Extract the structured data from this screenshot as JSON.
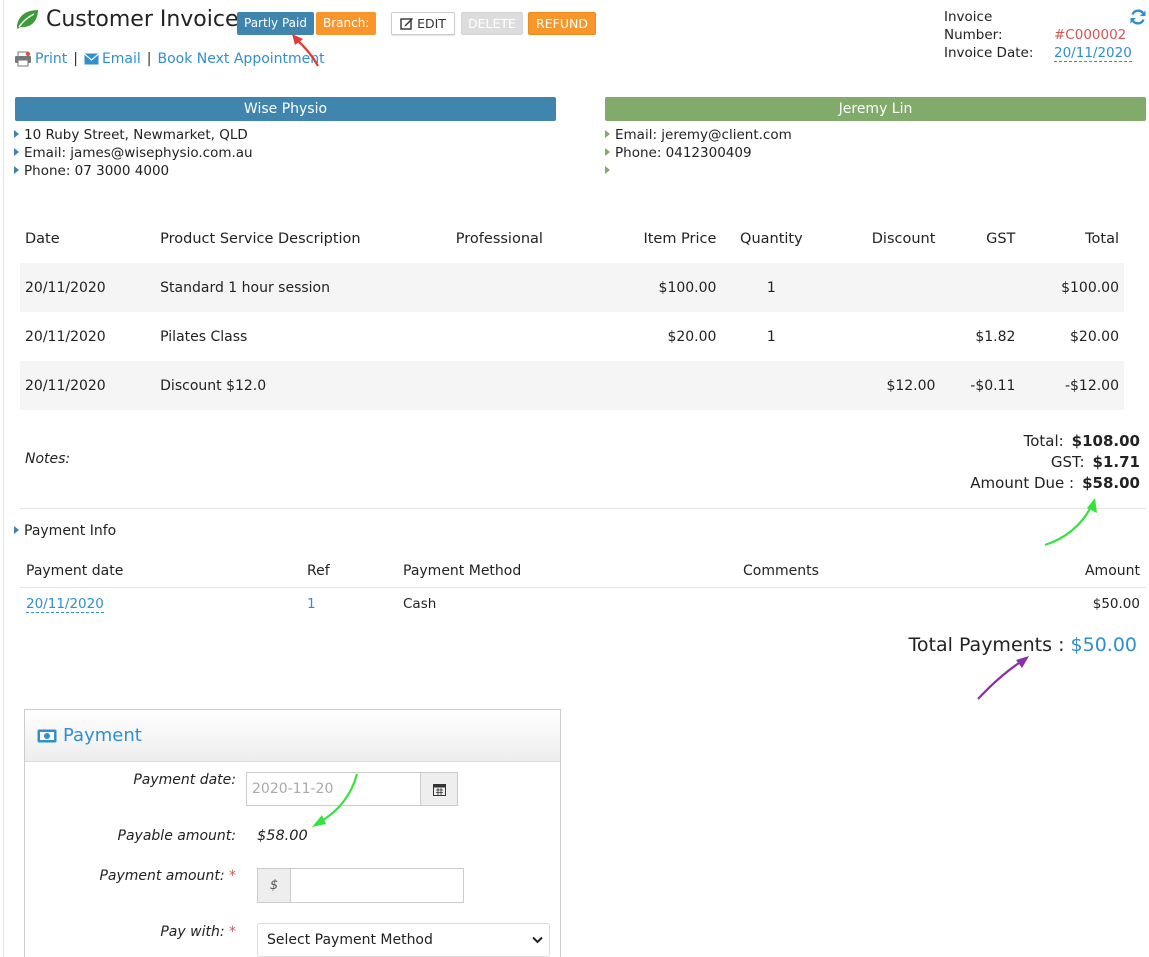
{
  "header": {
    "title": "Customer Invoice",
    "status_badge": "Partly Paid",
    "branch_badge": "Branch:",
    "edit_label": "EDIT",
    "delete_label": "DELETE",
    "refund_label": "REFUND"
  },
  "invoice": {
    "number_label": "Invoice Number:",
    "number": "#C000002",
    "date_label": "Invoice Date:",
    "date": "20/11/2020"
  },
  "actions": {
    "print": "Print",
    "email": "Email",
    "book": "Book Next Appointment",
    "separator": "|"
  },
  "business": {
    "name": "Wise Physio",
    "address": "10 Ruby Street, Newmarket, QLD",
    "email": "Email: james@wisephysio.com.au",
    "phone": "Phone: 07 3000 4000"
  },
  "client": {
    "name": "Jeremy Lin",
    "email": "Email: jeremy@client.com",
    "phone": "Phone: 0412300409"
  },
  "items_table": {
    "columns": [
      "Date",
      "Product Service Description",
      "Professional",
      "Item Price",
      "Quantity",
      "Discount",
      "GST",
      "Total"
    ],
    "rows": [
      [
        "20/11/2020",
        "Standard 1 hour session",
        "",
        "$100.00",
        "1",
        "",
        "",
        "$100.00"
      ],
      [
        "20/11/2020",
        "Pilates Class",
        "",
        "$20.00",
        "1",
        "",
        "$1.82",
        "$20.00"
      ],
      [
        "20/11/2020",
        "Discount $12.0",
        "",
        "",
        "",
        "$12.00",
        "-$0.11",
        "-$12.00"
      ]
    ]
  },
  "summary": {
    "notes_label": "Notes:",
    "total_label": "Total:",
    "total": "$108.00",
    "gst_label": "GST:",
    "gst": "$1.71",
    "due_label": "Amount Due :",
    "due": "$58.00"
  },
  "payment_info": {
    "title": "Payment Info",
    "columns": [
      "Payment date",
      "Ref",
      "Payment Method",
      "Comments",
      "Amount"
    ],
    "rows": [
      [
        "20/11/2020",
        "1",
        "Cash",
        "",
        "$50.00"
      ]
    ],
    "total_label": "Total Payments :",
    "total": "$50.00"
  },
  "payment_form": {
    "title": "Payment",
    "date_label": "Payment date:",
    "date_placeholder": "2020-11-20",
    "payable_label": "Payable amount:",
    "payable_value": "$58.00",
    "amount_label": "Payment amount:",
    "required_mark": "*",
    "currency_symbol": "$",
    "pay_with_label": "Pay with:",
    "pay_with_value": "Select Payment Method"
  },
  "colors": {
    "primary_blue": "#3f85ad",
    "client_green": "#80ab6b",
    "orange": "#f7962b",
    "link_blue": "#2f8fcf",
    "red": "#d9534f"
  }
}
